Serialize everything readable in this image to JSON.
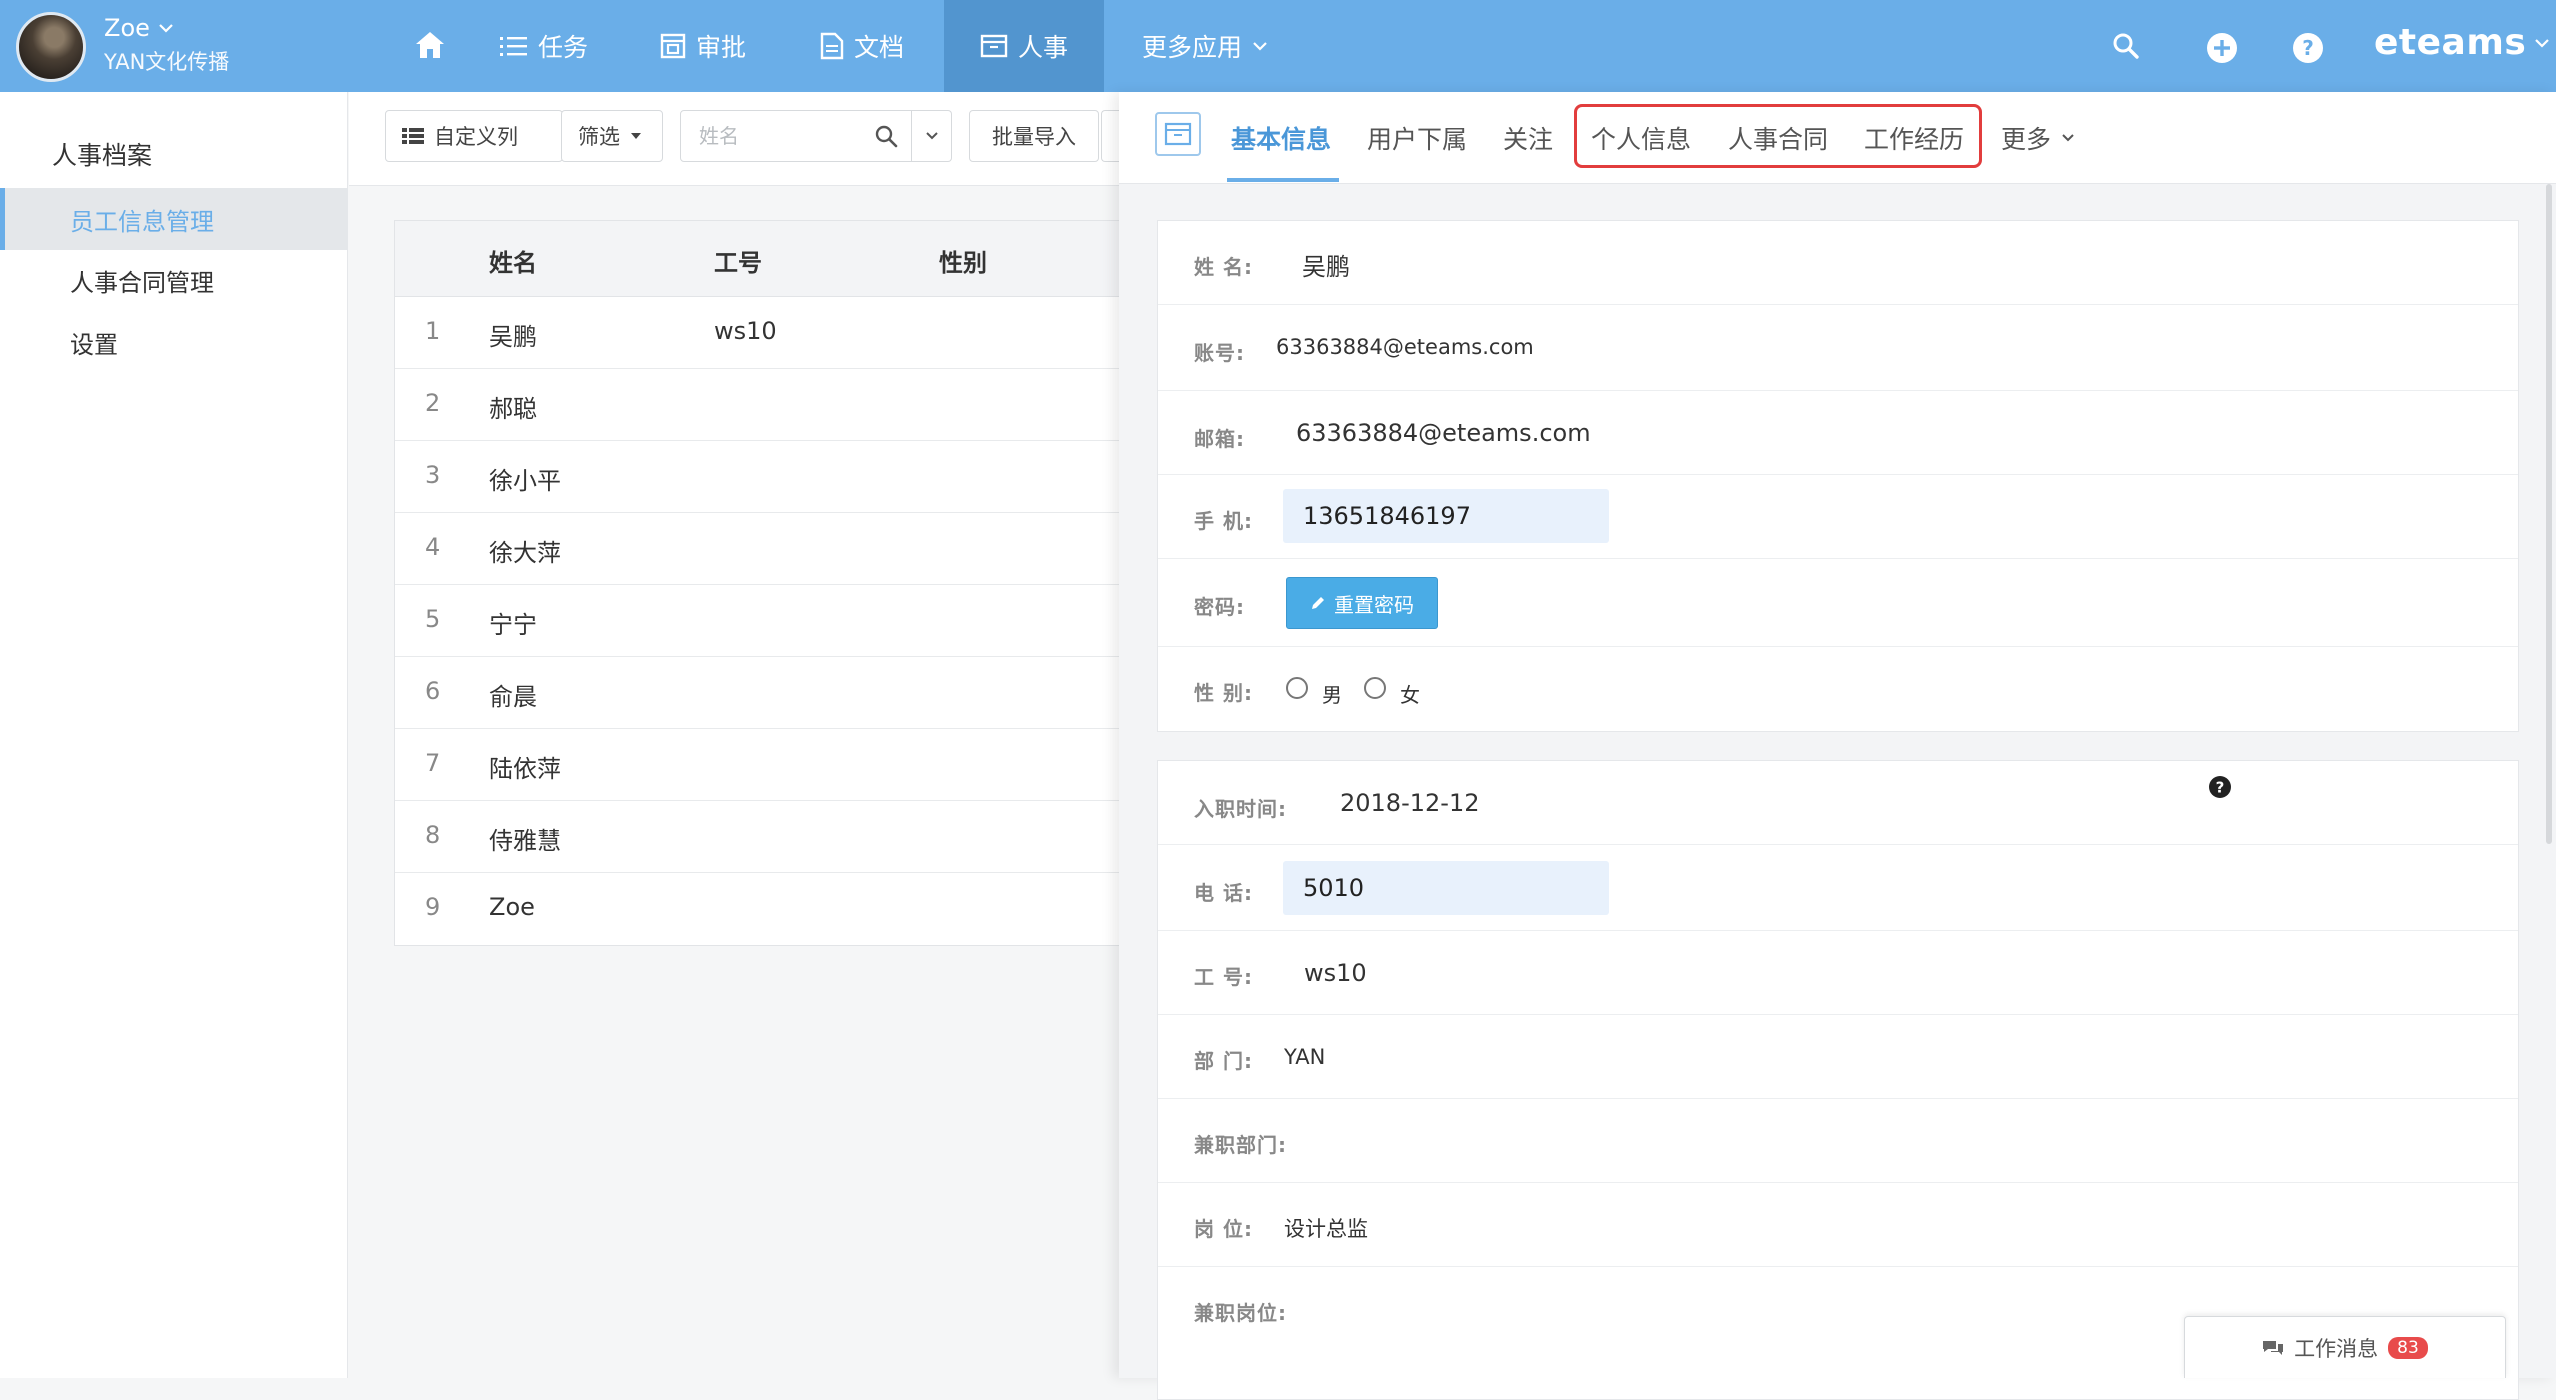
{
  "topbar": {
    "user_name": "Zoe",
    "org_name": "YAN文化传播",
    "nav": {
      "task": "任务",
      "approve": "审批",
      "docs": "文档",
      "hr": "人事",
      "more": "更多应用"
    },
    "brand": "eteams"
  },
  "sidebar": {
    "title": "人事档案",
    "items": [
      {
        "label": "员工信息管理"
      },
      {
        "label": "人事合同管理"
      },
      {
        "label": "设置"
      }
    ]
  },
  "list": {
    "toolbar": {
      "columns_label": "自定义列",
      "filter_label": "筛选",
      "search_placeholder": "姓名",
      "import_label": "批量导入"
    },
    "headers": {
      "name": "姓名",
      "no": "工号",
      "gender": "性别"
    },
    "rows": [
      {
        "idx": "1",
        "name": "吴鹏",
        "no": "ws10"
      },
      {
        "idx": "2",
        "name": "郝聪",
        "no": ""
      },
      {
        "idx": "3",
        "name": "徐小平",
        "no": ""
      },
      {
        "idx": "4",
        "name": "徐大萍",
        "no": ""
      },
      {
        "idx": "5",
        "name": "宁宁",
        "no": ""
      },
      {
        "idx": "6",
        "name": "俞晨",
        "no": ""
      },
      {
        "idx": "7",
        "name": "陆依萍",
        "no": ""
      },
      {
        "idx": "8",
        "name": "侍雅慧",
        "no": ""
      },
      {
        "idx": "9",
        "name": "Zoe",
        "no": ""
      }
    ]
  },
  "detail": {
    "tabs": {
      "basic": "基本信息",
      "sub": "用户下属",
      "follow": "关注",
      "personal": "个人信息",
      "contract": "人事合同",
      "work": "工作经历",
      "more": "更多"
    },
    "card1": {
      "name_label": "姓 名:",
      "name_value": "吴鹏",
      "account_label": "账号:",
      "account_value": "63363884@eteams.com",
      "email_label": "邮箱:",
      "email_value": "63363884@eteams.com",
      "mobile_label": "手 机:",
      "mobile_value": "13651846197",
      "password_label": "密码:",
      "reset_label": "重置密码",
      "gender_label": "性 别:",
      "gender_male": "男",
      "gender_female": "女"
    },
    "card2": {
      "join_label": "入职时间:",
      "join_value": "2018-12-12",
      "phone_label": "电 话:",
      "phone_value": "5010",
      "no_label": "工 号:",
      "no_value": "ws10",
      "dept_label": "部 门:",
      "dept_value": "YAN",
      "sub_dept_label": "兼职部门:",
      "post_label": "岗 位:",
      "post_value": "设计总监",
      "sub_post_label": "兼职岗位:"
    }
  },
  "messages": {
    "label": "工作消息",
    "count": "83"
  },
  "colors": {
    "accent": "#6aaee8",
    "highlight_border": "#e23d3d",
    "reset_button": "#4aace6",
    "badge": "#e84b4b"
  }
}
